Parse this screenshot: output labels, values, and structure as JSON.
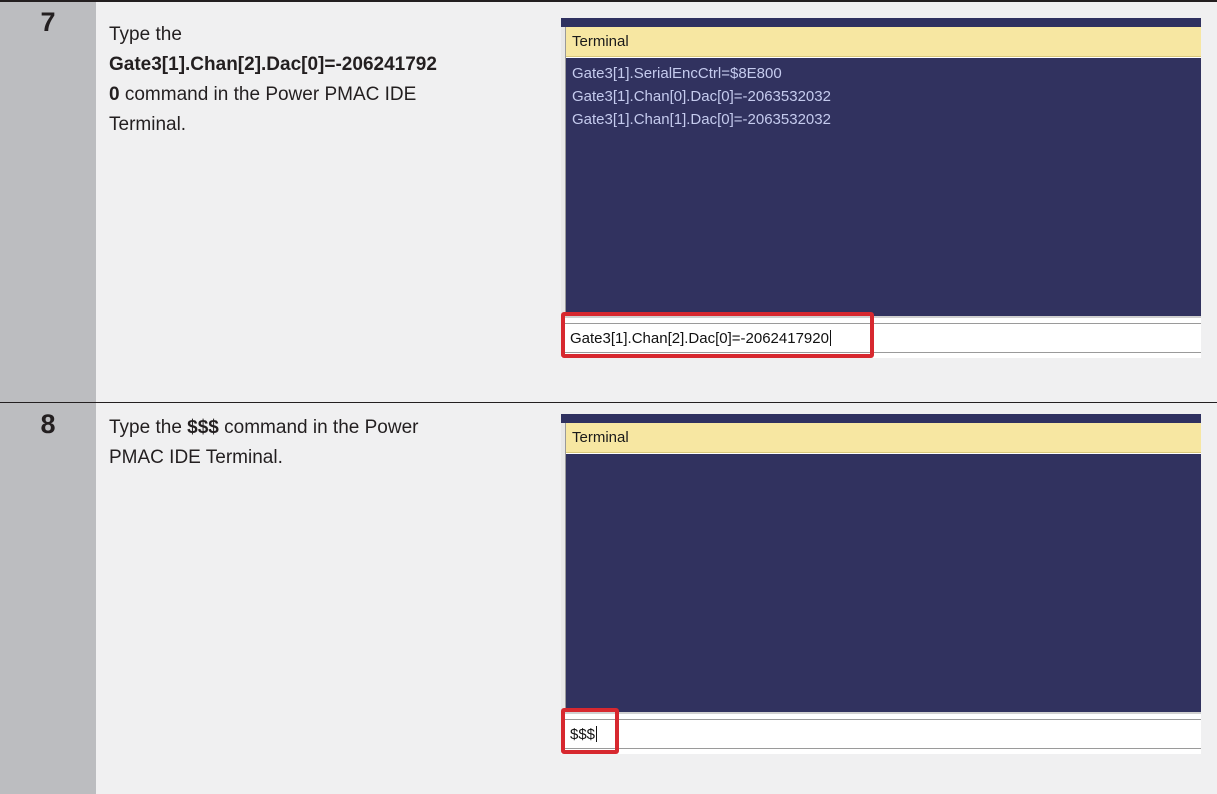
{
  "steps": [
    {
      "number": "7",
      "instruction": {
        "prefix": "Type the",
        "command_line1": "Gate3[1].Chan[2].Dac[0]=-206241792",
        "command_line2": "0",
        "suffix_line2": " command in the Power PMAC IDE",
        "suffix_line3": "Terminal."
      },
      "terminal": {
        "title": "Terminal",
        "output_lines": [
          "Gate3[1].SerialEncCtrl=$8E800",
          "Gate3[1].Chan[0].Dac[0]=-2063532032",
          "Gate3[1].Chan[1].Dac[0]=-2063532032"
        ],
        "input_value": "Gate3[1].Chan[2].Dac[0]=-2062417920"
      }
    },
    {
      "number": "8",
      "instruction": {
        "prefix": "Type the ",
        "command": "$$$",
        "suffix_line1": " command in the Power",
        "suffix_line2": "PMAC IDE Terminal."
      },
      "terminal": {
        "title": "Terminal",
        "output_lines": [],
        "input_value": "$$$"
      }
    }
  ],
  "colors": {
    "step_column": "#bcbdc0",
    "text_column": "#f0f0f1",
    "terminal_background": "#31325f",
    "terminal_title_bar": "#f7e7a2",
    "terminal_text": "#c5cbee",
    "highlight_box": "#d7282f"
  }
}
